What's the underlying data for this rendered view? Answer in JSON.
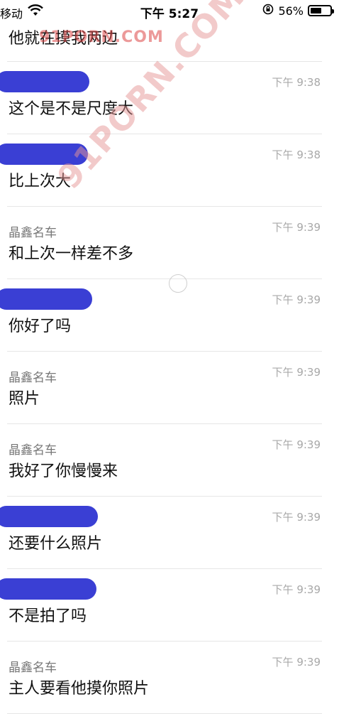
{
  "status_bar": {
    "carrier": "移动",
    "time": "下午 5:27",
    "battery_percent": "56%",
    "battery_level": 0.56
  },
  "top_fragment": "他就在摸我两边",
  "watermarks": {
    "small": "91PORN.COM",
    "large": "91PORN.COM"
  },
  "messages": [
    {
      "sender": "",
      "sender_redacted": true,
      "time": "下午 9:38",
      "text": "这个是不是尺度大"
    },
    {
      "sender": "",
      "sender_redacted": true,
      "time": "下午 9:38",
      "text": "比上次大"
    },
    {
      "sender": "晶鑫名车",
      "sender_redacted": false,
      "time": "下午 9:39",
      "text": "和上次一样差不多"
    },
    {
      "sender": "",
      "sender_redacted": true,
      "time": "下午 9:39",
      "text": "你好了吗"
    },
    {
      "sender": "晶鑫名车",
      "sender_redacted": false,
      "time": "下午 9:39",
      "text": "照片"
    },
    {
      "sender": "晶鑫名车",
      "sender_redacted": false,
      "time": "下午 9:39",
      "text": "我好了你慢慢来"
    },
    {
      "sender": "",
      "sender_redacted": true,
      "time": "下午 9:39",
      "text": "还要什么照片"
    },
    {
      "sender": "",
      "sender_redacted": true,
      "time": "下午 9:39",
      "text": "不是拍了吗"
    },
    {
      "sender": "晶鑫名车",
      "sender_redacted": false,
      "time": "下午 9:39",
      "text": "主人要看他摸你照片"
    }
  ],
  "colors": {
    "redaction": "#3a3fd4",
    "timestamp": "#a8a8a8",
    "sender": "#777777",
    "divider": "#e6e6e6"
  }
}
